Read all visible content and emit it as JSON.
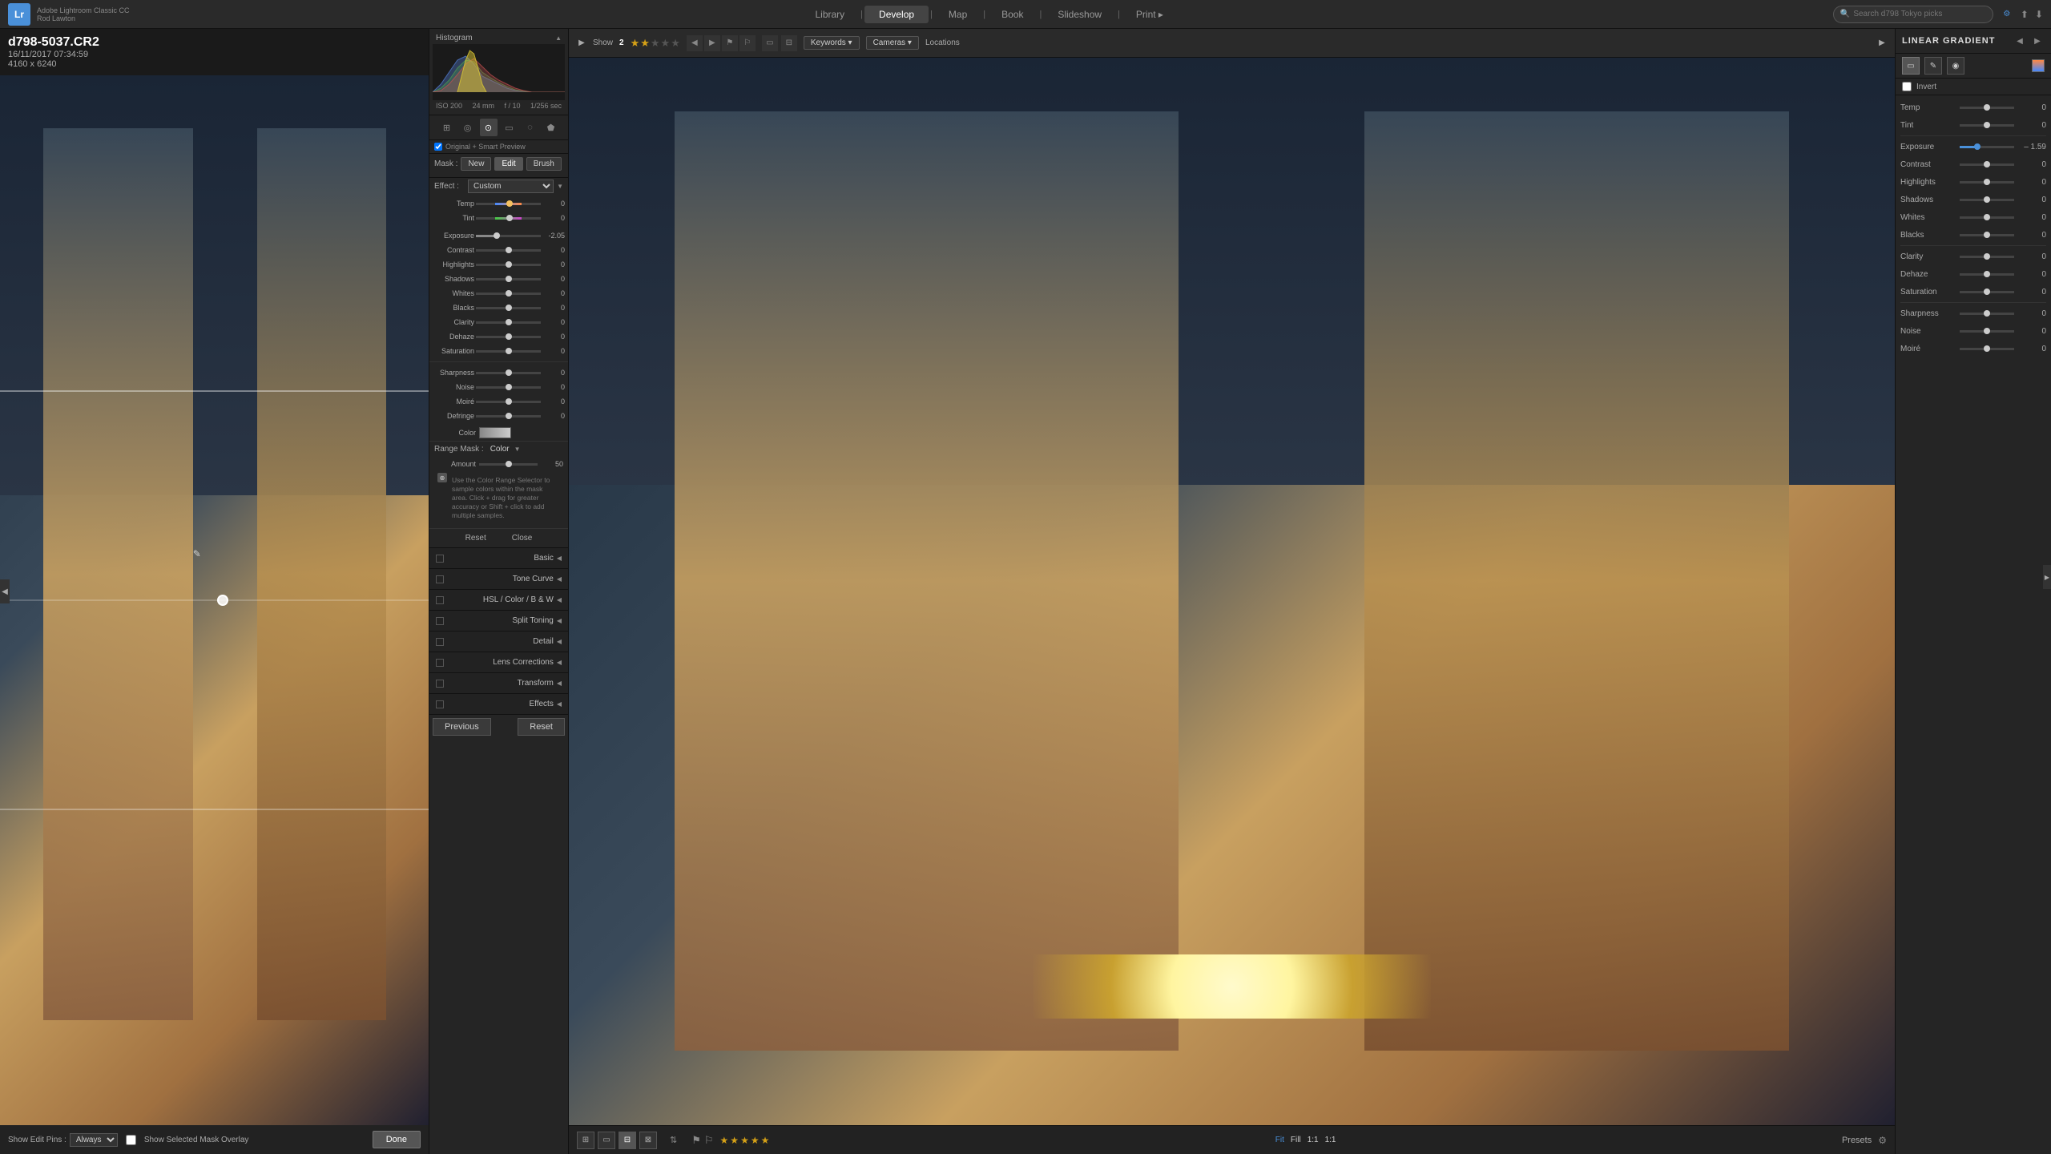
{
  "app": {
    "logo": "Lr",
    "title_line1": "Adobe Lightroom Classic CC",
    "title_line2": "Rod Lawton"
  },
  "nav": {
    "tabs": [
      "Library",
      "Develop",
      "Map",
      "Book",
      "Slideshow",
      "Print ▸"
    ],
    "active_tab": "Develop"
  },
  "search": {
    "placeholder": "Search d798 Tokyo picks",
    "value": ""
  },
  "image_info": {
    "filename": "d798-5037.CR2",
    "datetime": "16/11/2017 07:34:59",
    "dimensions": "4160 x 6240"
  },
  "toolbar": {
    "show_label": "Show",
    "show_count": "2",
    "keywords_label": "Keywords ▾",
    "cameras_label": "Cameras ▾",
    "locations_label": "Locations"
  },
  "histogram": {
    "title": "Histogram",
    "iso": "ISO 200",
    "focal": "24 mm",
    "aperture": "f / 10",
    "speed": "1/256 sec"
  },
  "preview_bar": {
    "label": "Original + Smart Preview"
  },
  "mask": {
    "label": "Mask :",
    "new_btn": "New",
    "edit_btn": "Edit",
    "brush_btn": "Brush"
  },
  "effect": {
    "label": "Effect :",
    "value": "Custom",
    "temp_label": "Temp",
    "tint_label": "Tint"
  },
  "sliders": {
    "exposure": {
      "label": "Exposure",
      "value": "-2.05",
      "percent": 32
    },
    "contrast": {
      "label": "Contrast",
      "value": "0",
      "percent": 50
    },
    "highlights": {
      "label": "Highlights",
      "value": "0",
      "percent": 50
    },
    "shadows": {
      "label": "Shadows",
      "value": "0",
      "percent": 50
    },
    "whites": {
      "label": "Whites",
      "value": "0",
      "percent": 50
    },
    "blacks": {
      "label": "Blacks",
      "value": "0",
      "percent": 50
    },
    "clarity": {
      "label": "Clarity",
      "value": "0",
      "percent": 50
    },
    "dehaze": {
      "label": "Dehaze",
      "value": "0",
      "percent": 50
    },
    "saturation": {
      "label": "Saturation",
      "value": "0",
      "percent": 50
    },
    "sharpness": {
      "label": "Sharpness",
      "value": "0",
      "percent": 50
    },
    "noise": {
      "label": "Noise",
      "value": "0",
      "percent": 50
    },
    "moire": {
      "label": "Moiré",
      "value": "0",
      "percent": 50
    },
    "defringe": {
      "label": "Defringe",
      "value": "0",
      "percent": 50
    }
  },
  "color_row": {
    "label": "Color"
  },
  "range_mask": {
    "label": "Range Mask :",
    "type": "Color",
    "amount_label": "Amount",
    "amount_value": "50",
    "hint": "Use the Color Range Selector to sample colors within the mask area. Click + drag for greater accuracy or Shift + click to add multiple samples."
  },
  "reset_close": {
    "reset_label": "Reset",
    "close_label": "Close"
  },
  "sections": {
    "basic": "Basic",
    "tone_curve": "Tone Curve",
    "hsl": "HSL",
    "color": "Color",
    "bw": "B & W",
    "split_toning": "Split Toning",
    "detail": "Detail",
    "lens_corrections": "Lens Corrections",
    "transform": "Transform",
    "effects": "Effects"
  },
  "bottom_actions": {
    "previous": "Previous",
    "reset": "Reset"
  },
  "show_edit_pins": {
    "label": "Show Edit Pins :",
    "value": "Always",
    "overlay_label": "Show Selected Mask Overlay"
  },
  "done_btn": "Done",
  "right_panel": {
    "title": "LINEAR GRADIENT",
    "invert_label": "Invert",
    "temp": {
      "label": "Temp",
      "value": "0",
      "percent": 50
    },
    "tint": {
      "label": "Tint",
      "value": "0",
      "percent": 50
    },
    "exposure": {
      "label": "Exposure",
      "value": "– 1.59",
      "percent": 32
    },
    "contrast": {
      "label": "Contrast",
      "value": "0",
      "percent": 50
    },
    "highlights": {
      "label": "Highlights",
      "value": "0",
      "percent": 50
    },
    "shadows": {
      "label": "Shadows",
      "value": "0",
      "percent": 50
    },
    "whites": {
      "label": "Whites",
      "value": "0",
      "percent": 50
    },
    "blacks": {
      "label": "Blacks",
      "value": "0",
      "percent": 50
    },
    "clarity": {
      "label": "Clarity",
      "value": "0",
      "percent": 50
    },
    "dehaze": {
      "label": "Dehaze",
      "value": "0",
      "percent": 50
    },
    "saturation": {
      "label": "Saturation",
      "value": "0",
      "percent": 50
    },
    "sharpness": {
      "label": "Sharpness",
      "value": "0",
      "percent": 50
    },
    "noise": {
      "label": "Noise",
      "value": "0",
      "percent": 50
    },
    "moire": {
      "label": "Moiré",
      "value": "0",
      "percent": 50
    }
  },
  "bottom_bar": {
    "fit_label": "Fit",
    "fill_label": "Fill",
    "one_to_one": "1:1",
    "zoom_label": "1:1",
    "presets_label": "Presets"
  },
  "stars": {
    "filled": 2,
    "total": 5
  }
}
